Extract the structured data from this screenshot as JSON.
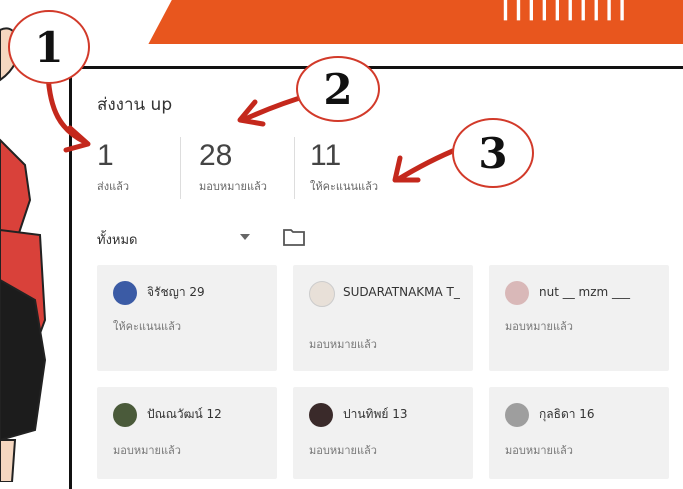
{
  "panel": {
    "title": "ส่งงาน up"
  },
  "stats": [
    {
      "value": "1",
      "label": "ส่งแล้ว"
    },
    {
      "value": "28",
      "label": "มอบหมายแล้ว"
    },
    {
      "value": "11",
      "label": "ให้คะแนนแล้ว"
    }
  ],
  "filter": {
    "selected": "ทั้งหมด"
  },
  "cards": [
    {
      "name": "จิรัชญา 29",
      "status": "ให้คะแนนแล้ว",
      "avatar_color": "#3b5ba5"
    },
    {
      "name": "SUDARATNAKMA T_",
      "status": "มอบหมายแล้ว",
      "avatar_color": "#e8e0d8"
    },
    {
      "name": "nut __ mzm ___",
      "status": "มอบหมายแล้ว",
      "avatar_color": "#d9b8b8"
    },
    {
      "name": "ปัณณวัฒน์ 12",
      "status": "มอบหมายแล้ว",
      "avatar_color": "#4a5a3a"
    },
    {
      "name": "ปานทิพย์ 13",
      "status": "มอบหมายแล้ว",
      "avatar_color": "#3a2a2a"
    },
    {
      "name": "กุลธิดา 16",
      "status": "มอบหมายแล้ว",
      "avatar_color": "#9e9e9e"
    }
  ],
  "callouts": [
    "1",
    "2",
    "3"
  ],
  "colors": {
    "banner": "#e8561e",
    "callout_border": "#d23a2a",
    "arrow": "#c4281c"
  }
}
